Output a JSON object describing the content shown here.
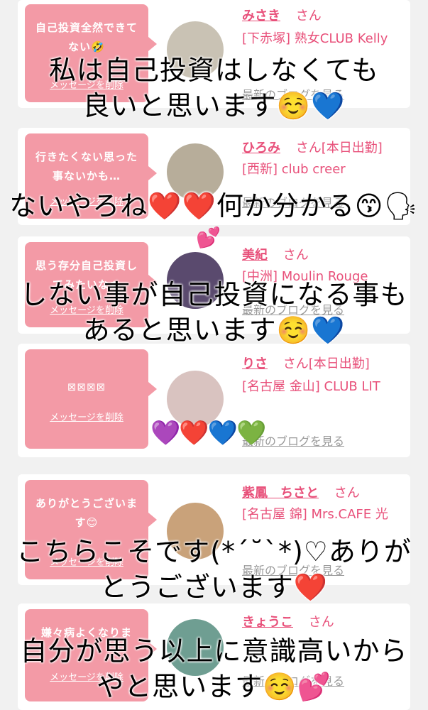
{
  "messages": [
    {
      "bubble": "自己投資全然できてない🤣",
      "delete_label": "メッセージを削除",
      "name": "みさき",
      "san": "さん",
      "shop": "[下赤塚] 熟女CLUB Kelly",
      "blog": "最新のブログを見る",
      "avatar_color": "#c9c2b4"
    },
    {
      "bubble": "行きたくない思った事ないかも…",
      "delete_label": "メッセージを削除",
      "name": "ひろみ",
      "san": "さん[本日出勤]",
      "shop": "[西新] club creer",
      "blog": "最新のブログを見る",
      "avatar_color": "#b7ad9a"
    },
    {
      "bubble": "思う存分自己投資してみたいなぁ",
      "delete_label": "メッセージを削除",
      "name": "美紀",
      "san": "さん",
      "shop": "[中洲] Moulin Rouge",
      "blog": "最新のブログを見る",
      "avatar_color": "#5a4a6e"
    },
    {
      "bubble": "⊠⊠⊠⊠",
      "delete_label": "メッセージを削除",
      "name": "りさ",
      "san": "さん[本日出勤]",
      "shop": "[名古屋 金山] CLUB LIT",
      "blog": "最新のブログを見る",
      "avatar_color": "#d9c3c0"
    },
    {
      "bubble": "ありがとうございます😊",
      "delete_label": "メッセージを削除",
      "name": "紫鳳　ちさと",
      "san": "さん",
      "shop": "[名古屋 錦] Mrs.CAFE 光",
      "blog": "最新のブログを見る",
      "avatar_color": "#c9a27a"
    },
    {
      "bubble": "嫌々病よくなりま",
      "delete_label": "メッセージを削除",
      "name": "きょうこ",
      "san": "さん",
      "shop": "",
      "blog": "最新のブログを見る",
      "avatar_color": "#6f9e92"
    }
  ],
  "overlays": {
    "o1_line1": "私は自己投資はしなくても",
    "o1_line2": "良いと思います☺️💙",
    "o2_line1": "ないやろね❤️❤️何か分かる😙🗣",
    "o3_line1": "しない事が自己投資になる事も",
    "o3_line2": "あると思います☺️💙",
    "o4_hearts": "💜❤️💙💚",
    "o5_line1": "こちらこそです(*´˘`*)♡ありが",
    "o5_line2": "とうございます❤️",
    "o6_line1": "自分が思う以上に意識高いから",
    "o6_line2": "やと思います☺️💕",
    "sparkle": "💕"
  }
}
